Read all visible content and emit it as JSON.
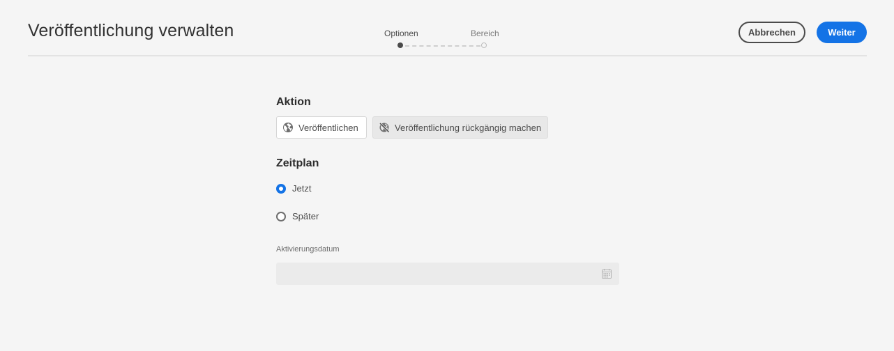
{
  "header": {
    "title": "Veröffentlichung verwalten",
    "steps": [
      {
        "label": "Optionen",
        "active": true
      },
      {
        "label": "Bereich",
        "active": false
      }
    ],
    "cancel_label": "Abbrechen",
    "next_label": "Weiter",
    "accent_color": "#1473e6"
  },
  "action_section": {
    "heading": "Aktion",
    "buttons": [
      {
        "label": "Veröffentlichen",
        "icon": "globe-icon"
      },
      {
        "label": "Veröffentlichung rückgängig machen",
        "icon": "globe-off-icon",
        "selected": true
      }
    ]
  },
  "schedule_section": {
    "heading": "Zeitplan",
    "options": [
      {
        "label": "Jetzt",
        "checked": true
      },
      {
        "label": "Später",
        "checked": false
      }
    ],
    "date_field": {
      "label": "Aktivierungsdatum",
      "value": "",
      "placeholder": "",
      "icon": "calendar-icon"
    }
  }
}
